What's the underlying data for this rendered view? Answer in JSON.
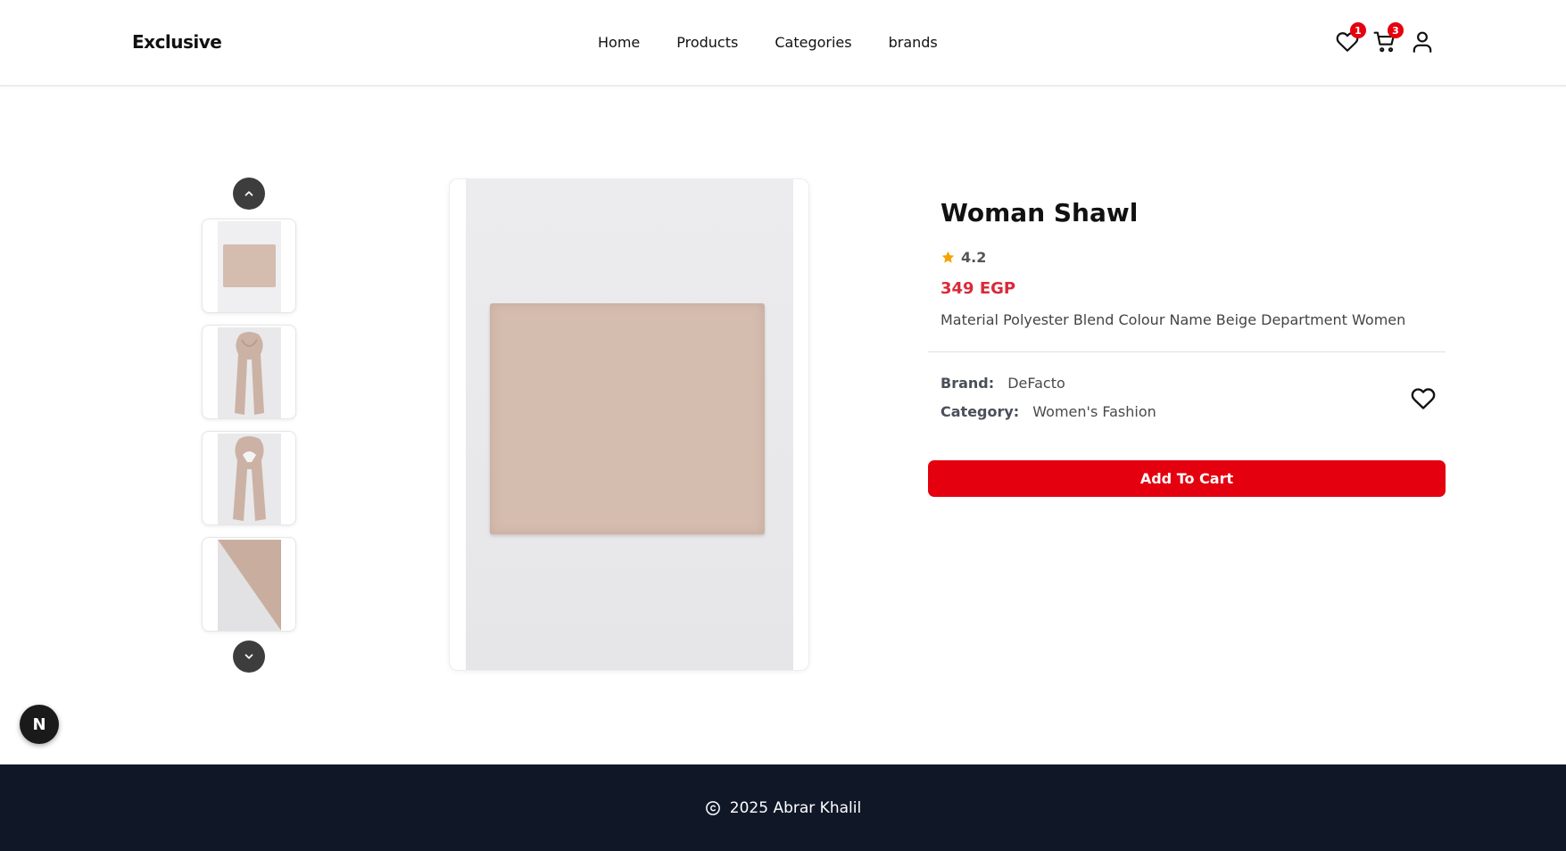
{
  "navbar": {
    "logo": "Exclusive",
    "links": [
      "Home",
      "Products",
      "Categories",
      "brands"
    ],
    "wishlist_count": "1",
    "cart_count": "3"
  },
  "product": {
    "title": "Woman Shawl",
    "rating": "4.2",
    "price": "349 EGP",
    "description": "Material Polyester Blend Colour Name Beige Department Women",
    "brand_label": "Brand:",
    "brand": "DeFacto",
    "category_label": "Category:",
    "category": "Women's Fashion",
    "add_to_cart": "Add To Cart"
  },
  "gallery": {
    "thumbnails": [
      "folded-shawl",
      "shawl-worn-front",
      "shawl-worn-knot",
      "shawl-corner-detail"
    ]
  },
  "floating": {
    "next_badge": "N"
  },
  "footer": {
    "text": "2025 Abrar Khalil"
  },
  "colors": {
    "accent": "#e4000f",
    "price": "#d92a3a",
    "footer_bg": "#101828",
    "star": "#f5a300",
    "shawl": "#d4bcaf"
  }
}
